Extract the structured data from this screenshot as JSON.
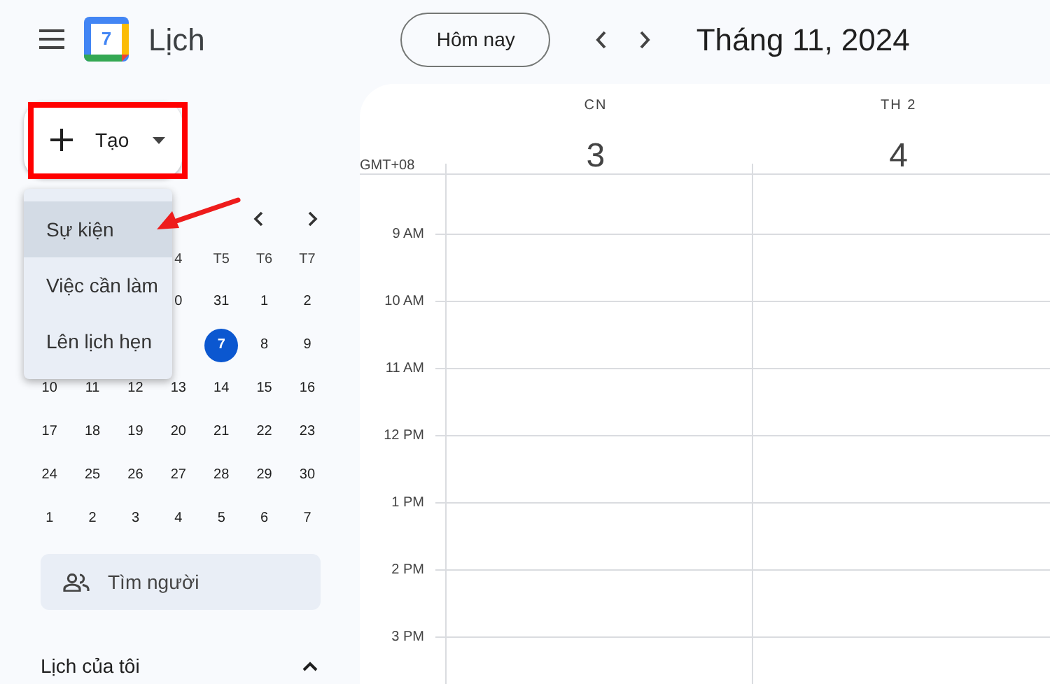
{
  "app": {
    "title": "Lịch",
    "logo_day": "7"
  },
  "toolbar": {
    "today_button": "Hôm nay",
    "period": "Tháng 11, 2024"
  },
  "create_button": {
    "label": "Tạo"
  },
  "create_menu": [
    {
      "label": "Sự kiện",
      "selected": true
    },
    {
      "label": "Việc cần làm",
      "selected": false
    },
    {
      "label": "Lên lịch hẹn",
      "selected": false
    }
  ],
  "mini_calendar": {
    "weekdays": [
      "4",
      "T5",
      "T6",
      "T7"
    ],
    "weeks": [
      [
        {
          "label": "0",
          "selected": false
        },
        {
          "label": "31",
          "selected": false
        },
        {
          "label": "1",
          "selected": false
        },
        {
          "label": "2",
          "selected": false
        }
      ],
      [
        {
          "label": "7",
          "selected": true
        },
        {
          "label": "8",
          "selected": false
        },
        {
          "label": "9",
          "selected": false
        }
      ],
      [
        {
          "label": "10",
          "selected": false
        },
        {
          "label": "11",
          "selected": false
        },
        {
          "label": "12",
          "selected": false
        },
        {
          "label": "13",
          "selected": false
        },
        {
          "label": "14",
          "selected": false
        },
        {
          "label": "15",
          "selected": false
        },
        {
          "label": "16",
          "selected": false
        }
      ],
      [
        {
          "label": "17",
          "selected": false
        },
        {
          "label": "18",
          "selected": false
        },
        {
          "label": "19",
          "selected": false
        },
        {
          "label": "20",
          "selected": false
        },
        {
          "label": "21",
          "selected": false
        },
        {
          "label": "22",
          "selected": false
        },
        {
          "label": "23",
          "selected": false
        }
      ],
      [
        {
          "label": "24",
          "selected": false
        },
        {
          "label": "25",
          "selected": false
        },
        {
          "label": "26",
          "selected": false
        },
        {
          "label": "27",
          "selected": false
        },
        {
          "label": "28",
          "selected": false
        },
        {
          "label": "29",
          "selected": false
        },
        {
          "label": "30",
          "selected": false
        }
      ],
      [
        {
          "label": "1",
          "selected": false
        },
        {
          "label": "2",
          "selected": false
        },
        {
          "label": "3",
          "selected": false
        },
        {
          "label": "4",
          "selected": false
        },
        {
          "label": "5",
          "selected": false
        },
        {
          "label": "6",
          "selected": false
        },
        {
          "label": "7",
          "selected": false
        }
      ]
    ]
  },
  "people_search": {
    "placeholder": "Tìm người"
  },
  "my_calendars": {
    "label": "Lịch của tôi",
    "expanded": true
  },
  "day_columns": [
    {
      "weekday": "CN",
      "date": "3"
    },
    {
      "weekday": "TH 2",
      "date": "4"
    }
  ],
  "timezone": "GMT+08",
  "hours": [
    "9 AM",
    "10 AM",
    "11 AM",
    "12 PM",
    "1 PM",
    "2 PM",
    "3 PM"
  ]
}
